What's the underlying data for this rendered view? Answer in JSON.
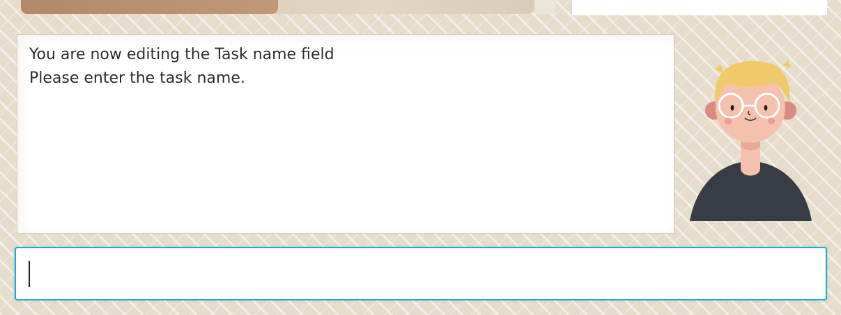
{
  "progress": {
    "value_percent": 50,
    "fill_color": "#b4896a",
    "track_color": "#d8c8af"
  },
  "message": {
    "lines": [
      "You are now editing the Task name field",
      "Please enter the task name."
    ]
  },
  "avatar": {
    "icon": "cartoon-person-with-glasses-icon",
    "hair_color": "#f0ca6a",
    "shirt_color": "#383c45",
    "skin_color": "#f3c1ad"
  },
  "input": {
    "value": "",
    "placeholder": "",
    "border_color": "#20a8cf"
  },
  "colors": {
    "background": "#e5dccb"
  }
}
